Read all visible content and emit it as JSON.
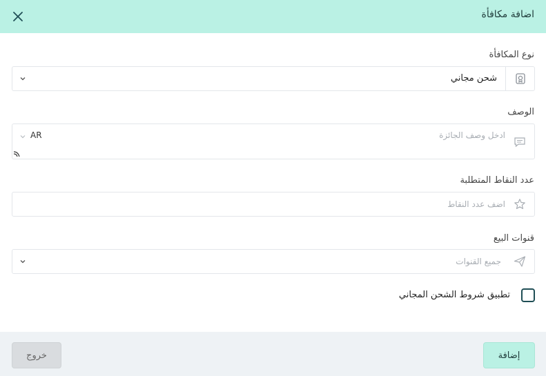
{
  "dialog": {
    "title": "اضافة مكافأة",
    "close_icon": "close-icon"
  },
  "reward_type": {
    "label": "نوع المكافأة",
    "value": "شحن مجاني",
    "icon": "badge-icon"
  },
  "description": {
    "label": "الوصف",
    "placeholder": "ادخل وصف الجائزة",
    "language": "AR",
    "icon": "comment-icon"
  },
  "points": {
    "label": "عدد النقاط المتطلبة",
    "placeholder": "اضف عدد النقاط",
    "icon": "star-icon"
  },
  "channels": {
    "label": "قنوات البيع",
    "placeholder": "جميع القنوات",
    "icon": "send-icon"
  },
  "free_shipping": {
    "label": "تطبيق شروط الشحن المجاني",
    "checked": false
  },
  "footer": {
    "add_label": "إضافة",
    "exit_label": "خروج"
  },
  "colors": {
    "header_bg": "#baf1e4",
    "primary_text": "#1f3b3a",
    "footer_bg": "#eef2f5"
  }
}
